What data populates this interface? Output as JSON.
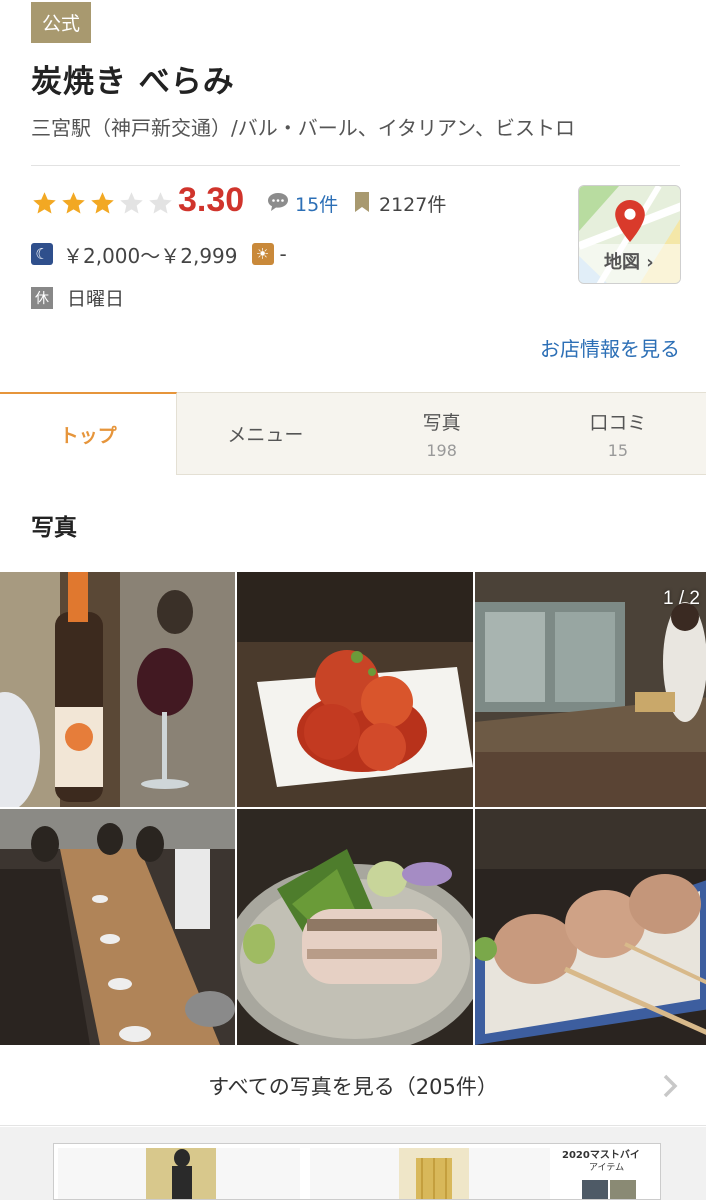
{
  "header": {
    "badge": "公式",
    "name": "炭焼き べらみ",
    "subtitle": "三宮駅（神戸新交通）/バル・バール、イタリアン、ビストロ"
  },
  "stats": {
    "rating": "3.30",
    "star_rating": 3,
    "review_count": "15件",
    "bookmark_count": "2127件"
  },
  "map": {
    "label": "地図 ›"
  },
  "price": {
    "dinner_icon": "☾",
    "dinner": "￥2,000～￥2,999",
    "lunch_icon": "☀",
    "lunch": "-"
  },
  "holiday": {
    "badge": "休",
    "text": "日曜日"
  },
  "info_link": "お店情報を見る",
  "tabs": [
    {
      "label": "トップ",
      "count": ""
    },
    {
      "label": "メニュー",
      "count": ""
    },
    {
      "label": "写真",
      "count": "198"
    },
    {
      "label": "口コミ",
      "count": "15"
    }
  ],
  "photos": {
    "title": "写真",
    "pager": "1 / 2",
    "all_label": "すべての写真を見る（205件）"
  },
  "ad": {
    "line1": "2020マストバイ",
    "line2": "アイテム"
  },
  "colors": {
    "accent": "#e6953b",
    "rating": "#d0342c",
    "link": "#2c6fb6",
    "badge": "#a8996f",
    "star": "#f2a823"
  },
  "icons": [
    "star-icon",
    "speech-bubble-icon",
    "bookmark-icon",
    "map-pin-icon",
    "moon-icon",
    "sun-icon",
    "chevron-right-icon"
  ]
}
